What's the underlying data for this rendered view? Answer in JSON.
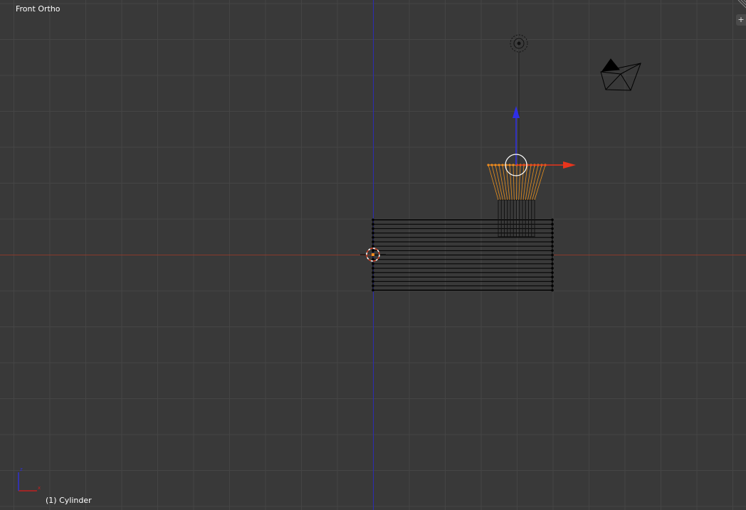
{
  "viewport": {
    "view_name": "Front Ortho",
    "active_object": "(1) Cylinder",
    "add_widget_symbol": "+"
  },
  "colors": {
    "background": "#393939",
    "grid_line": "#454545",
    "x_axis": "#8a3a2a",
    "z_axis": "#2b2bb5",
    "selected": "#f08c1e",
    "wire": "#000000",
    "gizmo_x": "#e8341c",
    "gizmo_y": "#2e2ee8"
  },
  "icons": {
    "lamp": "lamp-icon",
    "camera": "camera-icon",
    "cursor": "3d-cursor-icon",
    "axes": "axes-navigation-icon",
    "manipulator": "transform-manipulator-icon"
  }
}
